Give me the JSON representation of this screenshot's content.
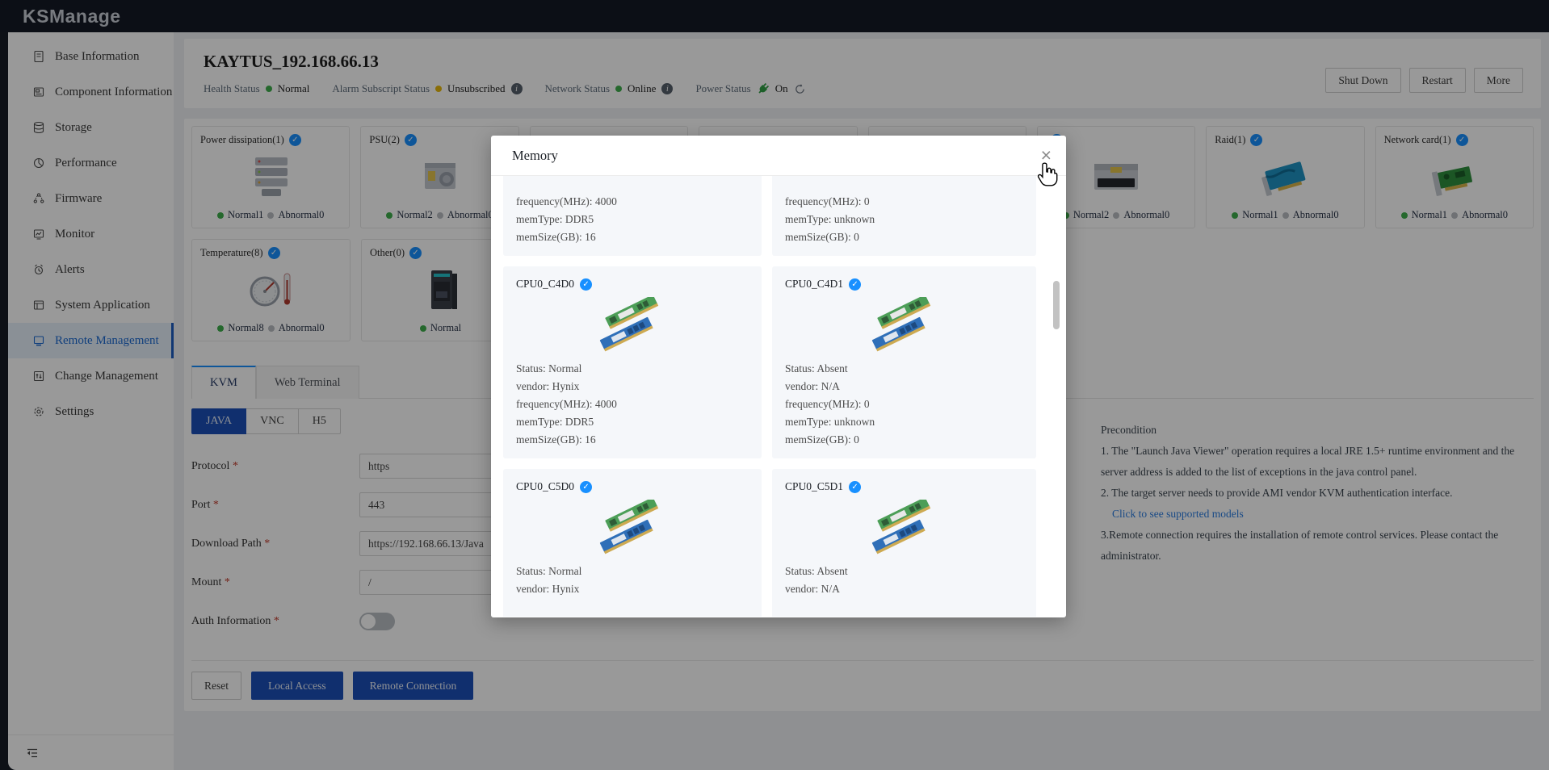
{
  "app": {
    "logo": "KSManage"
  },
  "icons": {
    "check": "✓",
    "info": "i"
  },
  "sidebar": {
    "items": [
      {
        "label": "Base Information"
      },
      {
        "label": "Component Information"
      },
      {
        "label": "Storage"
      },
      {
        "label": "Performance"
      },
      {
        "label": "Firmware"
      },
      {
        "label": "Monitor"
      },
      {
        "label": "Alerts"
      },
      {
        "label": "System Application"
      },
      {
        "label": "Remote Management"
      },
      {
        "label": "Change Management"
      },
      {
        "label": "Settings"
      }
    ],
    "active_index": 8
  },
  "page": {
    "title": "KAYTUS_192.168.66.13",
    "actions": {
      "shutdown": "Shut Down",
      "restart": "Restart",
      "more": "More"
    },
    "status": {
      "health": {
        "label": "Health Status",
        "value": "Normal"
      },
      "alarm": {
        "label": "Alarm Subscript Status",
        "value": "Unsubscribed"
      },
      "network": {
        "label": "Network Status",
        "value": "Online"
      },
      "power": {
        "label": "Power Status",
        "value": "On"
      }
    }
  },
  "cards": {
    "row1": [
      {
        "label": "Power dissipation(1)",
        "normal": "Normal1",
        "abnormal": "Abnormal0"
      },
      {
        "label": "PSU(2)",
        "normal": "Normal2",
        "abnormal": "Abnormal0"
      },
      {
        "label": "",
        "normal": "",
        "abnormal": ""
      },
      {
        "label": "",
        "normal": "",
        "abnormal": ""
      },
      {
        "label": "",
        "normal": "",
        "abnormal": ""
      },
      {
        "label": "",
        "normal": "Normal2",
        "abnormal": "Abnormal0"
      },
      {
        "label": "Raid(1)",
        "normal": "Normal1",
        "abnormal": "Abnormal0"
      },
      {
        "label": "Network card(1)",
        "normal": "Normal1",
        "abnormal": "Abnormal0"
      }
    ],
    "row2": [
      {
        "label": "Temperature(8)",
        "normal": "Normal8",
        "abnormal": "Abnormal0"
      },
      {
        "label": "Other(0)",
        "normal": "Normal",
        "abnormal": ""
      }
    ]
  },
  "kvm": {
    "tabs": [
      {
        "label": "KVM"
      },
      {
        "label": "Web Terminal"
      }
    ],
    "viewers": [
      {
        "label": "JAVA"
      },
      {
        "label": "VNC"
      },
      {
        "label": "H5"
      }
    ],
    "fields": {
      "protocol": {
        "label": "Protocol",
        "value": "https"
      },
      "port": {
        "label": "Port",
        "value": "443"
      },
      "download_path": {
        "label": "Download Path",
        "value": "https://192.168.66.13/Java"
      },
      "mount": {
        "label": "Mount",
        "value": "/"
      },
      "auth": {
        "label": "Auth Information"
      }
    },
    "buttons": {
      "reset": "Reset",
      "local": "Local Access",
      "remote": "Remote Connection"
    }
  },
  "precondition": {
    "title": "Precondition",
    "line1": "1. The \"Launch Java Viewer\" operation requires a local JRE 1.5+ runtime environment and the server address is added to the list of exceptions in the java control panel.",
    "line2": "2. The target server needs to provide AMI vendor KVM authentication interface.",
    "link": "Click to see supported models",
    "line3": "3.Remote connection requires the installation of remote control services. Please contact the administrator."
  },
  "modal": {
    "title": "Memory",
    "close": "×",
    "items": [
      {
        "name": "",
        "lines": [
          "frequency(MHz): 4000",
          "memType: DDR5",
          "memSize(GB): 16"
        ]
      },
      {
        "name": "",
        "lines": [
          "frequency(MHz): 0",
          "memType: unknown",
          "memSize(GB): 0"
        ]
      },
      {
        "name": "CPU0_C4D0",
        "lines": [
          "Status: Normal",
          "vendor: Hynix",
          "frequency(MHz): 4000",
          "memType: DDR5",
          "memSize(GB): 16"
        ]
      },
      {
        "name": "CPU0_C4D1",
        "lines": [
          "Status: Absent",
          "vendor: N/A",
          "frequency(MHz): 0",
          "memType: unknown",
          "memSize(GB): 0"
        ]
      },
      {
        "name": "CPU0_C5D0",
        "lines": [
          "Status: Normal",
          "vendor: Hynix"
        ]
      },
      {
        "name": "CPU0_C5D1",
        "lines": [
          "Status: Absent",
          "vendor: N/A"
        ]
      }
    ]
  }
}
